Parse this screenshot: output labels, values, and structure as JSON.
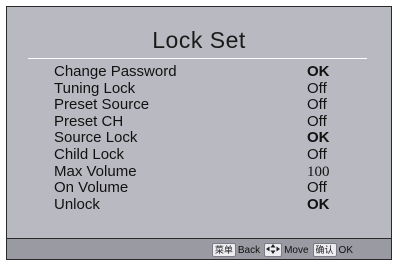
{
  "title": "Lock Set",
  "items": [
    {
      "label": "Change Password",
      "value": "OK"
    },
    {
      "label": "Tuning Lock",
      "value": "Off"
    },
    {
      "label": "Preset Source",
      "value": "Off"
    },
    {
      "label": "Preset CH",
      "value": "Off"
    },
    {
      "label": "Source Lock",
      "value": "OK"
    },
    {
      "label": "Child Lock",
      "value": "Off"
    },
    {
      "label": "Max Volume",
      "value": "100"
    },
    {
      "label": "On Volume",
      "value": "Off"
    },
    {
      "label": "Unlock",
      "value": "OK"
    }
  ],
  "footer": {
    "menu_key": "菜单",
    "back_label": "Back",
    "move_label": "Move",
    "confirm_key": "确认",
    "ok_label": "OK"
  },
  "colors": {
    "panel_bg": "#b9b9c1",
    "footer_bg": "#9a9aa3"
  }
}
